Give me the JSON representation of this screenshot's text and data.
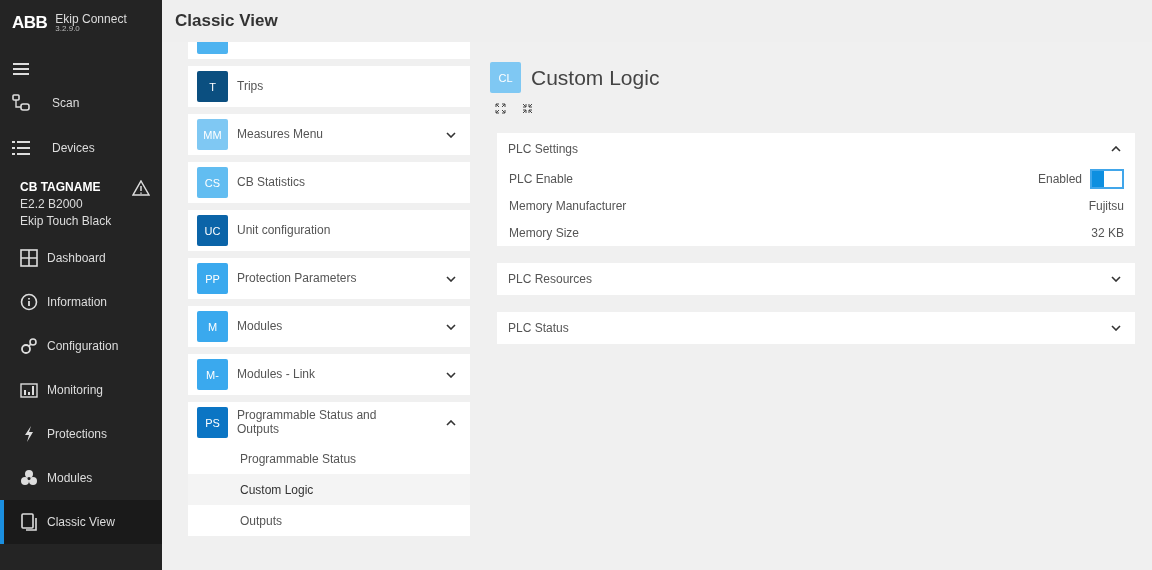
{
  "app": {
    "logo": "ABB",
    "name": "Ekip Connect",
    "version": "3.2.9.0"
  },
  "sidebar": {
    "top_items": [
      {
        "label": "Scan"
      },
      {
        "label": "Devices"
      }
    ],
    "device": {
      "tag": "CB TAGNAME",
      "model": "E2.2 B2000",
      "unit": "Ekip Touch Black",
      "warning": true
    },
    "items": [
      {
        "label": "Dashboard",
        "selected": false
      },
      {
        "label": "Information",
        "selected": false
      },
      {
        "label": "Configuration",
        "selected": false
      },
      {
        "label": "Monitoring",
        "selected": false
      },
      {
        "label": "Protections",
        "selected": false
      },
      {
        "label": "Modules",
        "selected": false
      },
      {
        "label": "Classic View",
        "selected": true
      }
    ]
  },
  "header": {
    "title": "Classic View"
  },
  "menu": [
    {
      "color": "#4db3f0"
    },
    {
      "badge": "T",
      "label": "Trips",
      "color": "#0b4f80"
    },
    {
      "badge": "MM",
      "label": "Measures Menu",
      "color": "#7fc8f3",
      "expanded": false
    },
    {
      "badge": "CS",
      "label": "CB Statistics",
      "color": "#62bdf1"
    },
    {
      "badge": "UC",
      "label": "Unit configuration",
      "color": "#0b64a8"
    },
    {
      "badge": "PP",
      "label": "Protection Parameters",
      "color": "#3aa9ee",
      "expanded": false
    },
    {
      "badge": "M",
      "label": "Modules",
      "color": "#3aa9ee",
      "expanded": false
    },
    {
      "badge": "M-",
      "label": "Modules - Link",
      "color": "#3aa9ee",
      "expanded": false
    },
    {
      "badge": "PS",
      "label": "Programmable Status and Outputs",
      "color": "#0b75c4",
      "expanded": true,
      "children": [
        {
          "label": "Programmable Status",
          "selected": false
        },
        {
          "label": "Custom Logic",
          "selected": true
        },
        {
          "label": "Outputs",
          "selected": false
        }
      ]
    }
  ],
  "page": {
    "badge": "CL",
    "title": "Custom Logic",
    "sections": [
      {
        "title": "PLC Settings",
        "expanded": true,
        "rows": [
          {
            "kind": "toggle",
            "label": "PLC Enable",
            "value": "Enabled",
            "on": true
          },
          {
            "kind": "text",
            "label": "Memory Manufacturer",
            "value": "Fujitsu"
          },
          {
            "kind": "text",
            "label": "Memory Size",
            "value": "32 KB"
          }
        ]
      },
      {
        "title": "PLC Resources",
        "expanded": false
      },
      {
        "title": "PLC Status",
        "expanded": false
      }
    ]
  }
}
